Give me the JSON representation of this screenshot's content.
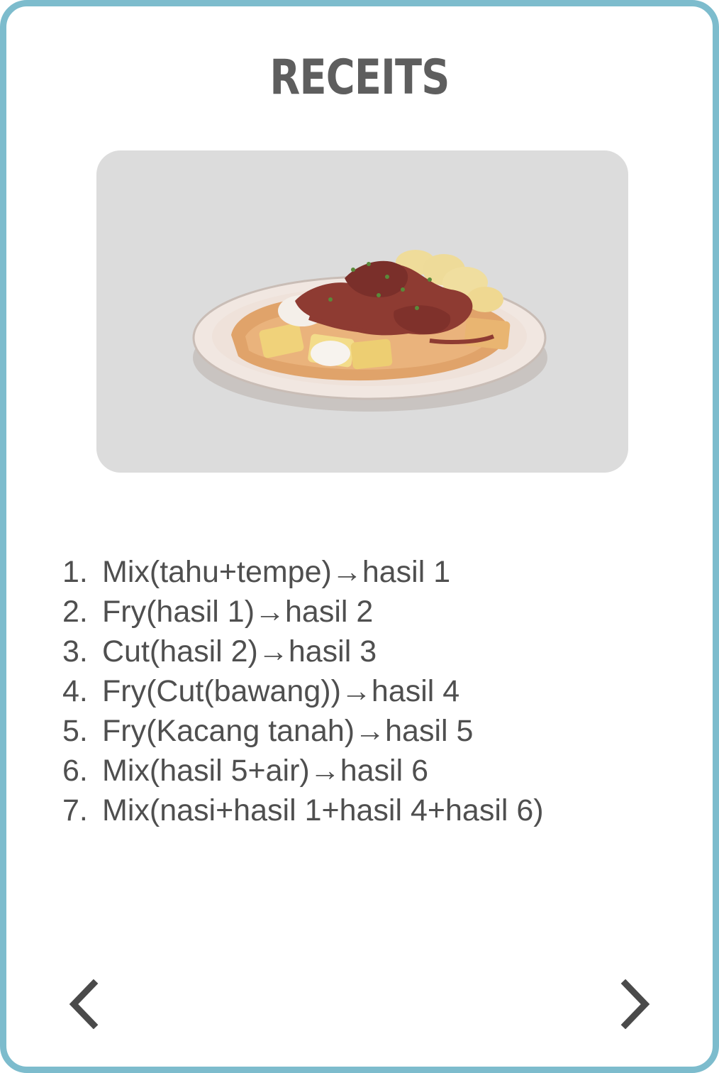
{
  "title": "RECEITS",
  "image": {
    "subject": "food-plate-icon"
  },
  "steps": [
    {
      "number": "1.",
      "text": "Mix(tahu+tempe)→hasil 1"
    },
    {
      "number": "2.",
      "text": "Fry(hasil 1)→hasil 2"
    },
    {
      "number": "3.",
      "text": "Cut(hasil 2)→hasil 3"
    },
    {
      "number": "4.",
      "text": "Fry(Cut(bawang))→hasil 4"
    },
    {
      "number": "5.",
      "text": "Fry(Kacang tanah)→hasil 5"
    },
    {
      "number": "6.",
      "text": "Mix(hasil 5+air)→hasil 6"
    },
    {
      "number": "7.",
      "text": "Mix(nasi+hasil 1+hasil 4+hasil 6)"
    }
  ],
  "navigation": {
    "prev_icon": "chevron-left-icon",
    "next_icon": "chevron-right-icon"
  },
  "colors": {
    "border": "#7dbccd",
    "title": "#5e5e5e",
    "panel": "#dcdcdc",
    "text": "#4f4f4f",
    "chevron": "#4a4a4a"
  }
}
